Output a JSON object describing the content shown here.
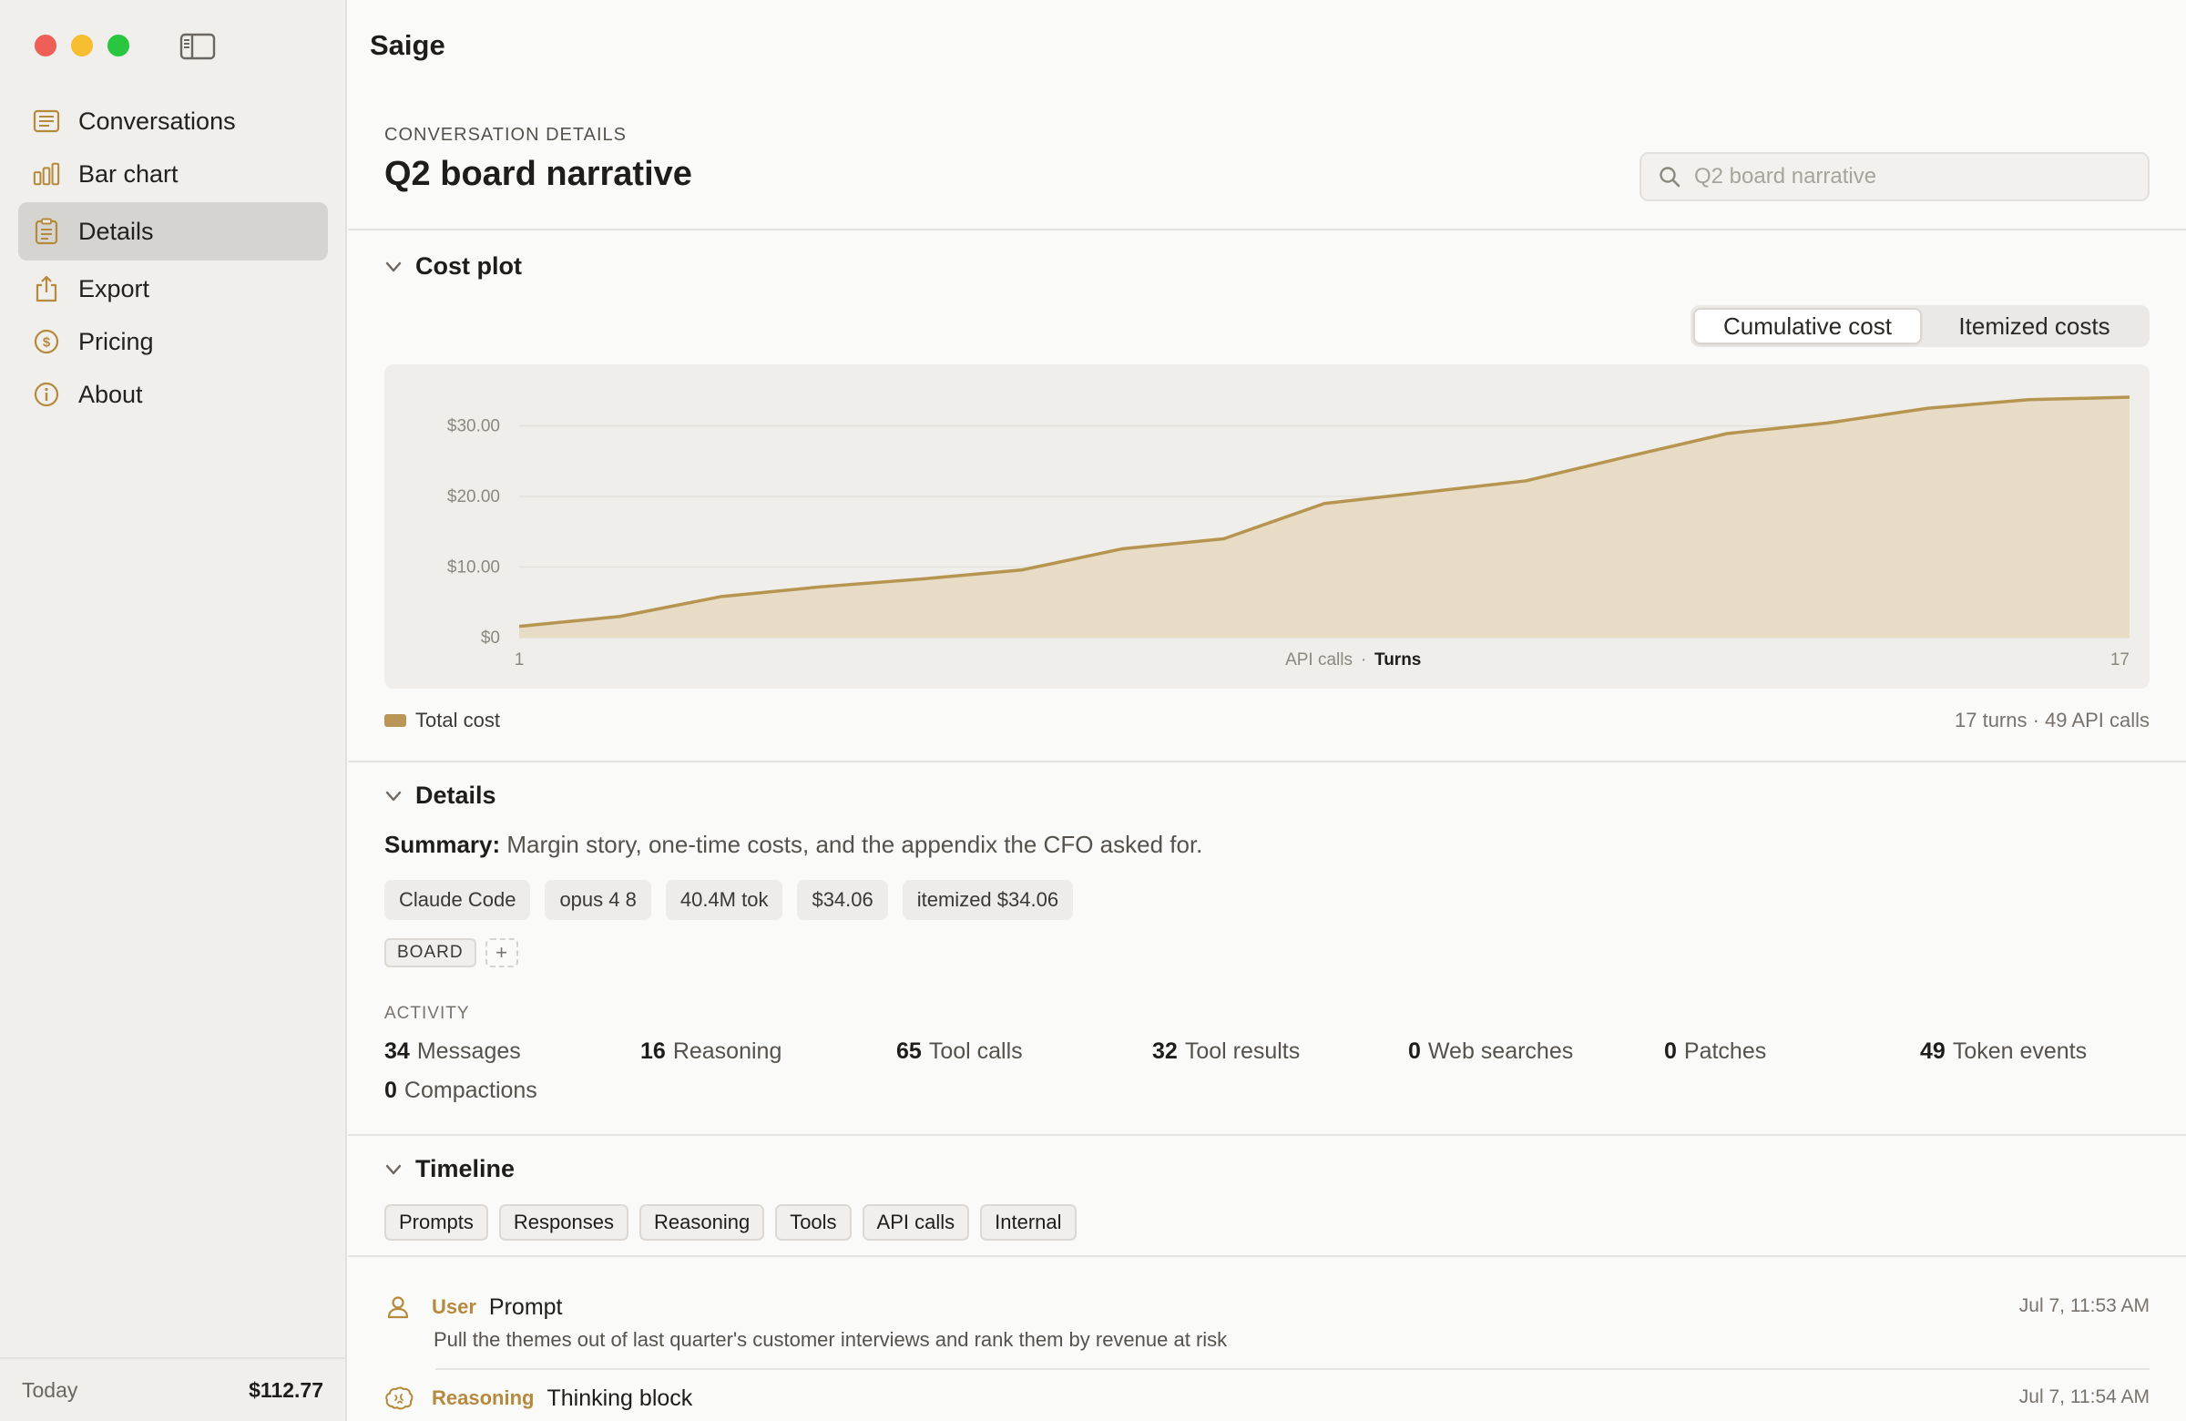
{
  "app": {
    "title": "Saige"
  },
  "sidebar": {
    "items": [
      {
        "label": "Conversations",
        "icon": "list-icon"
      },
      {
        "label": "Bar chart",
        "icon": "bar-chart-icon"
      },
      {
        "label": "Details",
        "icon": "clipboard-icon"
      },
      {
        "label": "Export",
        "icon": "share-icon"
      },
      {
        "label": "Pricing",
        "icon": "dollar-icon"
      },
      {
        "label": "About",
        "icon": "info-icon"
      }
    ],
    "active": "Details",
    "footer": {
      "label": "Today",
      "value": "$112.77"
    }
  },
  "header": {
    "eyebrow": "CONVERSATION DETAILS",
    "title": "Q2 board narrative",
    "search_placeholder": "Q2 board narrative"
  },
  "cost_plot": {
    "heading": "Cost plot",
    "toggle": {
      "options": [
        "Cumulative cost",
        "Itemized costs"
      ],
      "selected": "Cumulative cost"
    },
    "legend": "Total cost",
    "meta": "17 turns · 49 API calls"
  },
  "chart_data": {
    "type": "area",
    "x": [
      1,
      2,
      3,
      4,
      5,
      6,
      7,
      8,
      9,
      10,
      11,
      12,
      13,
      14,
      15,
      16,
      17
    ],
    "series": [
      {
        "name": "Total cost",
        "values": [
          1.6,
          3.0,
          5.8,
          7.2,
          8.3,
          9.6,
          12.6,
          14.0,
          19.0,
          20.6,
          22.2,
          25.6,
          28.9,
          30.4,
          32.5,
          33.7,
          34.06
        ]
      }
    ],
    "ylim": [
      0,
      34.06
    ],
    "yticks": [
      "$0",
      "$10.00",
      "$20.00",
      "$30.00"
    ],
    "ytick_values": [
      0,
      10,
      20,
      30
    ],
    "xtick_start": "1",
    "xtick_end": "17",
    "xlabel_left": "API calls",
    "xlabel_sep": "·",
    "xlabel_right": "Turns",
    "colors": {
      "line": "#b69550",
      "fill": "#e8dcc6"
    }
  },
  "details": {
    "heading": "Details",
    "summary_label": "Summary:",
    "summary_text": "Margin story, one-time costs, and the appendix the CFO asked for.",
    "chips": [
      "Claude Code",
      "opus 4 8",
      "40.4M tok",
      "$34.06",
      "itemized $34.06"
    ],
    "tags": [
      "BOARD"
    ],
    "add_tag": "+",
    "activity_label": "ACTIVITY",
    "activity": [
      {
        "n": "34",
        "label": "Messages"
      },
      {
        "n": "16",
        "label": "Reasoning"
      },
      {
        "n": "65",
        "label": "Tool calls"
      },
      {
        "n": "32",
        "label": "Tool results"
      },
      {
        "n": "0",
        "label": "Web searches"
      },
      {
        "n": "0",
        "label": "Patches"
      },
      {
        "n": "49",
        "label": "Token events"
      },
      {
        "n": "0",
        "label": "Compactions"
      }
    ]
  },
  "timeline": {
    "heading": "Timeline",
    "filters": [
      "Prompts",
      "Responses",
      "Reasoning",
      "Tools",
      "API calls",
      "Internal"
    ],
    "items": [
      {
        "role": "User",
        "kind": "Prompt",
        "time": "Jul 7, 11:53 AM",
        "body": "Pull the themes out of last quarter's customer interviews and rank them by revenue at risk"
      },
      {
        "role": "Reasoning",
        "kind": "Thinking block",
        "time": "Jul 7, 11:54 AM",
        "body": ""
      }
    ]
  }
}
